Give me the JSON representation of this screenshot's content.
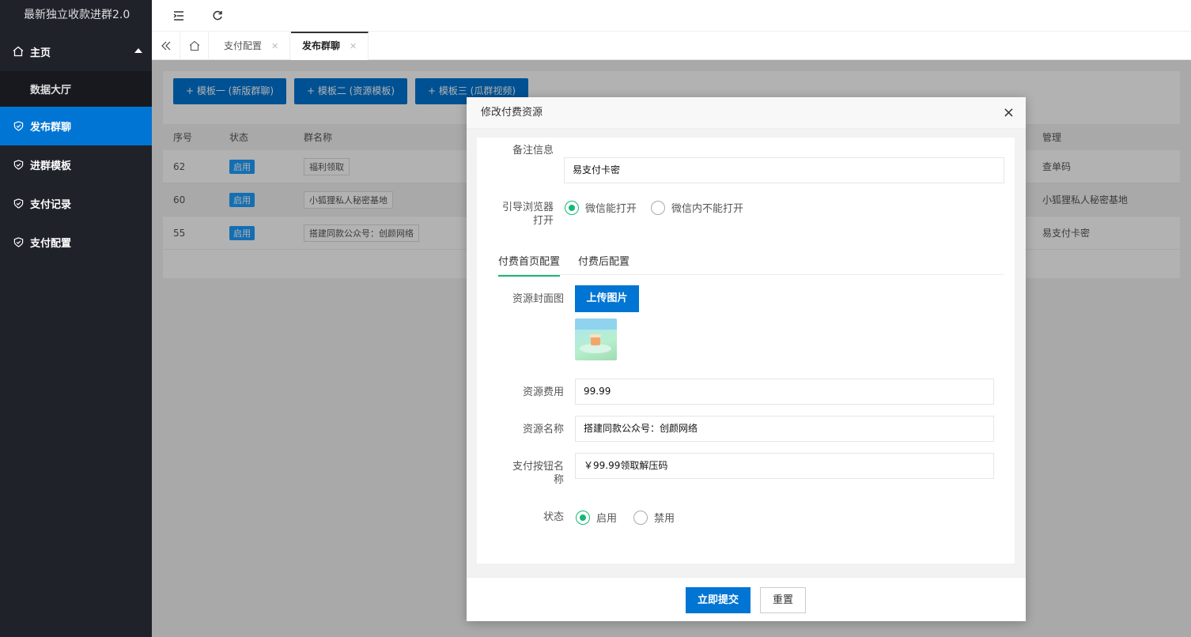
{
  "app": {
    "title": "最新独立收款进群2.0"
  },
  "sidebar": {
    "items": [
      {
        "label": "主页"
      },
      {
        "label": "数据大厅"
      },
      {
        "label": "发布群聊"
      },
      {
        "label": "进群模板"
      },
      {
        "label": "支付记录"
      },
      {
        "label": "支付配置"
      }
    ]
  },
  "tabs": [
    {
      "label": "支付配置"
    },
    {
      "label": "发布群聊"
    }
  ],
  "toolbar": {
    "btn1": "+ 模板一 (新版群聊)",
    "btn2": "+ 模板二 (资源模板)",
    "btn3": "+ 模板三 (瓜群视频)"
  },
  "table": {
    "headers": {
      "id": "序号",
      "status": "状态",
      "name": "群名称",
      "manage": "管理"
    },
    "rows": [
      {
        "id": "62",
        "status": "启用",
        "name": "福利领取",
        "manage": "查单码"
      },
      {
        "id": "60",
        "status": "启用",
        "name": "小狐狸私人秘密基地",
        "manage": "小狐狸私人秘密基地"
      },
      {
        "id": "55",
        "status": "启用",
        "name": "搭建同款公众号：创颜网络",
        "manage": "易支付卡密"
      }
    ]
  },
  "modal": {
    "title": "修改付费资源",
    "close": "×",
    "remark_label": "备注信息",
    "remark_value": "易支付卡密",
    "guide_label_1": "引导浏览器",
    "guide_label_2": "打开",
    "guide_opt1": "微信能打开",
    "guide_opt2": "微信内不能打开",
    "subtab1": "付费首页配置",
    "subtab2": "付费后配置",
    "cover_label": "资源封面图",
    "upload_label": "上传图片",
    "fee_label": "资源费用",
    "fee_value": "99.99",
    "name_label": "资源名称",
    "name_value": "搭建同款公众号：创颜网络",
    "paybtn_label_1": "支付按钮名",
    "paybtn_label_2": "称",
    "paybtn_value": "￥99.99领取解压码",
    "status_label": "状态",
    "status_opt1": "启用",
    "status_opt2": "禁用",
    "submit": "立即提交",
    "reset": "重置"
  }
}
